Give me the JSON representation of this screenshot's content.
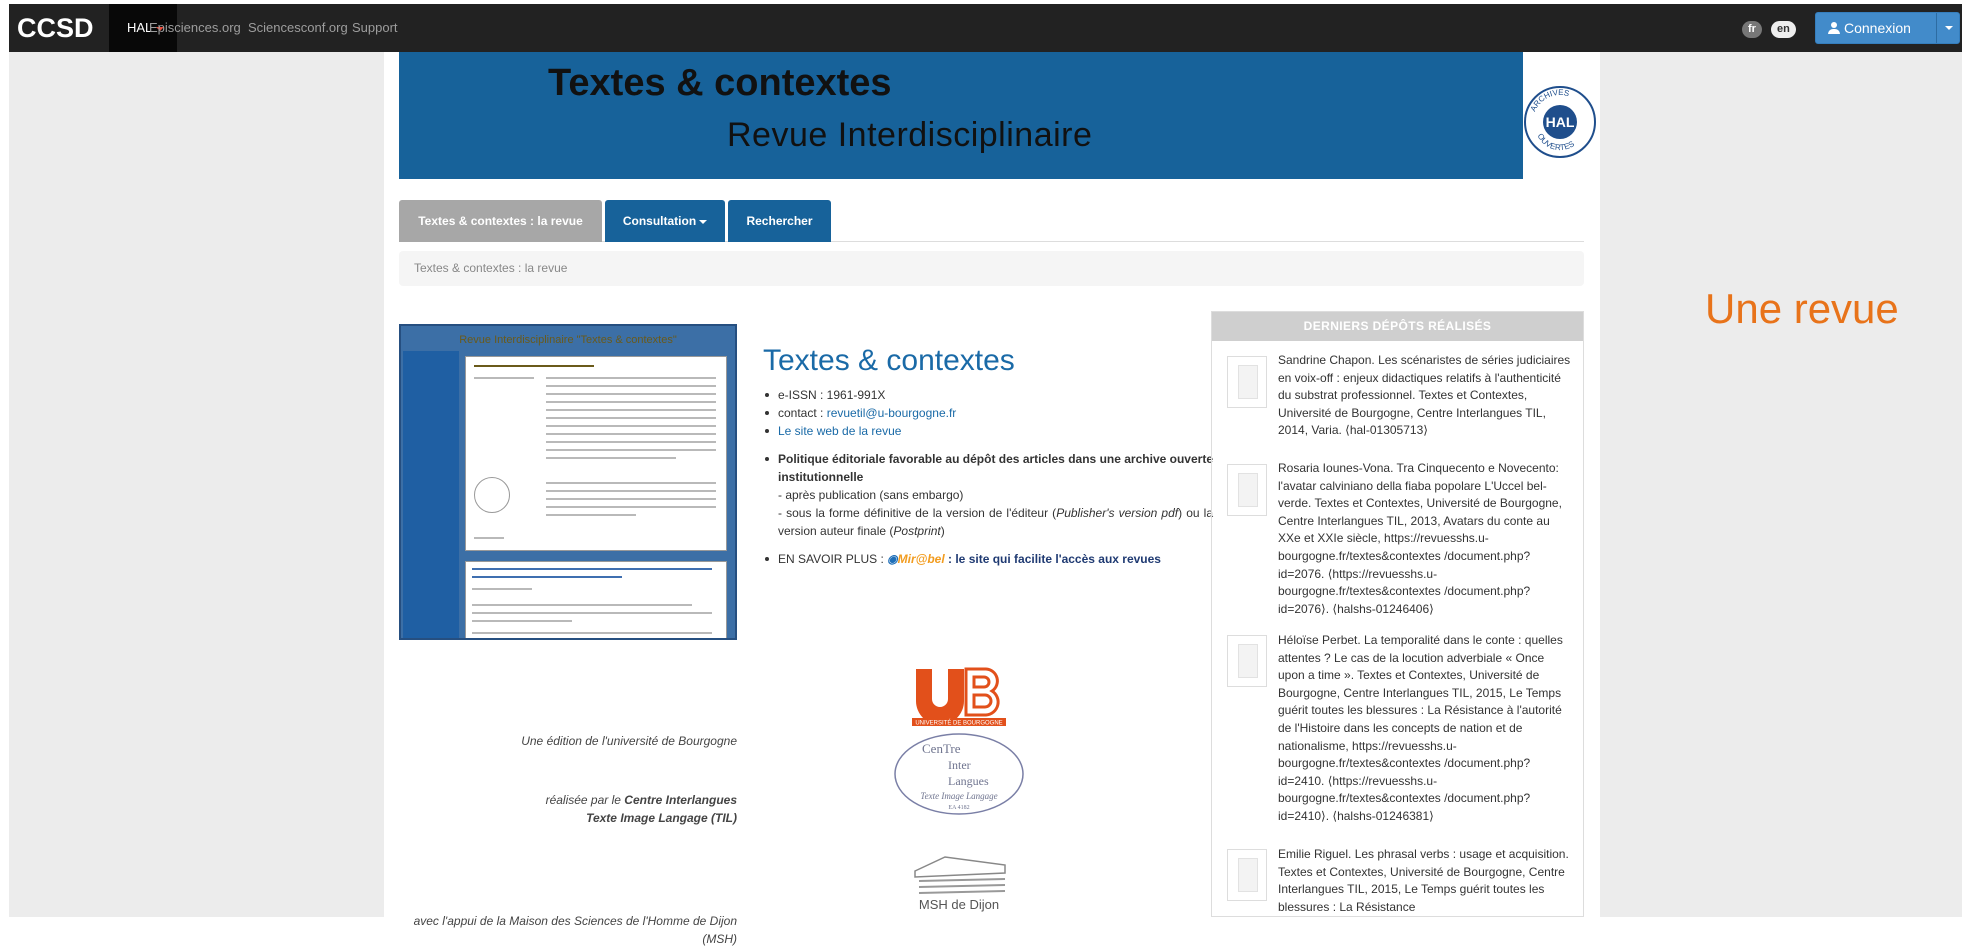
{
  "navbar": {
    "brand": "CCSD",
    "hal_label": "HAL",
    "links": [
      "Episciences.org",
      "Sciencesconf.org",
      "Support"
    ],
    "lang_fr": "fr",
    "lang_en": "en",
    "login_label": "Connexion"
  },
  "banner": {
    "title": "Textes & contextes",
    "subtitle": "Revue Interdisciplinaire"
  },
  "tabs": [
    {
      "label": "Textes & contextes : la revue"
    },
    {
      "label": "Consultation"
    },
    {
      "label": "Rechercher"
    }
  ],
  "breadcrumb": "Textes & contextes : la revue",
  "thumbnail": {
    "title": "Revue Interdisciplinaire \"Textes & contextes\""
  },
  "journal": {
    "title": "Textes & contextes",
    "issn": "e-ISSN : 1961-991X",
    "contact_prefix": "contact : ",
    "contact_email": "revuetil@u-bourgogne.fr",
    "website": "Le site web de la revue",
    "policy_bold": "Politique éditoriale favorable au dépôt des articles dans une archive ouverte institutionnelle",
    "policy_1": "- après publication (sans embargo)",
    "policy_2a": "- sous la forme définitive de la version de l'éditeur (",
    "policy_2b": "Publisher's version pdf",
    "policy_2c": ") ou la version auteur finale (",
    "policy_2d": "Postprint",
    "policy_2e": ")",
    "more_prefix": "EN SAVOIR PLUS : ",
    "more_logo": "Mir@bel",
    "more_text": " : le site qui facilite l'accès aux revues"
  },
  "credits": {
    "edition": "Une édition de l'université de Bourgogne",
    "realisee_prefix": "réalisée par le ",
    "realisee_bold_1": "Centre Interlangues",
    "realisee_bold_2": "Texte Image Langage (TIL)",
    "appui": "avec l'appui de la Maison des Sciences de l'Homme de Dijon (MSH)",
    "ub_caption": "UNIVERSITÉ DE BOURGOGNE",
    "til_line1": "CenTre",
    "til_line2": "Inter",
    "til_line3": "Langues",
    "til_line4": "Texte Image Langage",
    "til_code": "EA 4182",
    "msh_caption": "MSH de Dijon"
  },
  "sidebar": {
    "heading": "DERNIERS DÉPÔTS RÉALISÉS",
    "deposits": [
      {
        "text": "Sandrine Chapon. Les scénaristes de séries judiciaires en voix-off : enjeux didactiques relatifs à l'authenticité du substrat professionnel. Textes et Contextes, Université de Bourgogne, Centre Interlangues TIL, 2014, Varia. ⟨hal-01305713⟩"
      },
      {
        "text": "Rosaria Iounes-Vona. Tra Cinquecento e Novecento: l'avatar calviniano della fiaba popolare L'Uccel bel-verde. Textes et Contextes, Université de Bourgogne, Centre Interlangues TIL, 2013, Avatars du conte au XXe et XXIe siècle, https://revuesshs.u-bourgogne.fr/textes&contextes /document.php?id=2076. ⟨https://revuesshs.u-bourgogne.fr/textes&contextes /document.php?id=2076⟩. ⟨halshs-01246406⟩"
      },
      {
        "text": "Héloïse Perbet. La temporalité dans le conte : quelles attentes ? Le cas de la locution adverbiale « Once upon a time ». Textes et Contextes, Université de Bourgogne, Centre Interlangues TIL, 2015, Le Temps guérit toutes les blessures : La Résistance à l'autorité de l'Histoire dans les concepts de nation et de nationalisme, https://revuesshs.u-bourgogne.fr/textes&contextes /document.php?id=2410. ⟨https://revuesshs.u-bourgogne.fr/textes&contextes /document.php?id=2410⟩. ⟨halshs-01246381⟩"
      },
      {
        "text": "Emilie Riguel. Les phrasal verbs : usage et acquisition. Textes et Contextes, Université de Bourgogne, Centre Interlangues TIL, 2015, Le Temps guérit toutes les blessures : La Résistance"
      }
    ]
  },
  "overlay_label": "Une revue",
  "colors": {
    "navbar": "#222222",
    "accent_blue": "#17629a",
    "link_blue": "#1a6aa7",
    "tab_gray": "#a7a7a7",
    "overlay_orange": "#e8731a",
    "ub_red": "#e2501b"
  }
}
